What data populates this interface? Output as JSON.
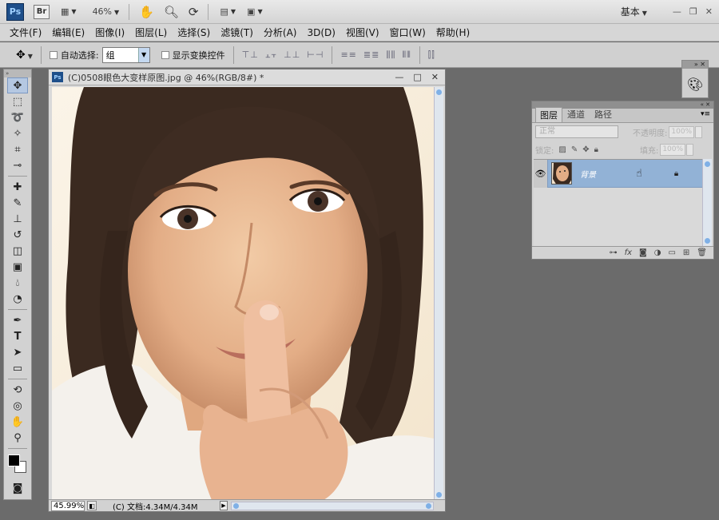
{
  "appbar": {
    "ps_logo": "Ps",
    "br_logo": "Br",
    "zoom": "46%",
    "workspace": "基本"
  },
  "menu": [
    "文件(F)",
    "编辑(E)",
    "图像(I)",
    "图层(L)",
    "选择(S)",
    "滤镜(T)",
    "分析(A)",
    "3D(D)",
    "视图(V)",
    "窗口(W)",
    "帮助(H)"
  ],
  "options": {
    "auto_select_label": "自动选择:",
    "auto_select_value": "组",
    "show_transform_label": "显示变换控件"
  },
  "document": {
    "title": "(C)0508眼色大变样原图.jpg @ 46%(RGB/8#) *",
    "status_zoom": "45.99%",
    "status_doc": "(C) 文档:4.34M/4.34M"
  },
  "layers_panel": {
    "tabs": [
      "图层",
      "通道",
      "路径"
    ],
    "blend_mode": "正常",
    "opacity_label": "不透明度:",
    "opacity_value": "100%",
    "lock_label": "锁定:",
    "fill_label": "填充:",
    "fill_value": "100%",
    "layer_name": "背景"
  },
  "colors": {
    "accent": "#92b2d6",
    "workspace_bg": "#6b6b6b"
  }
}
